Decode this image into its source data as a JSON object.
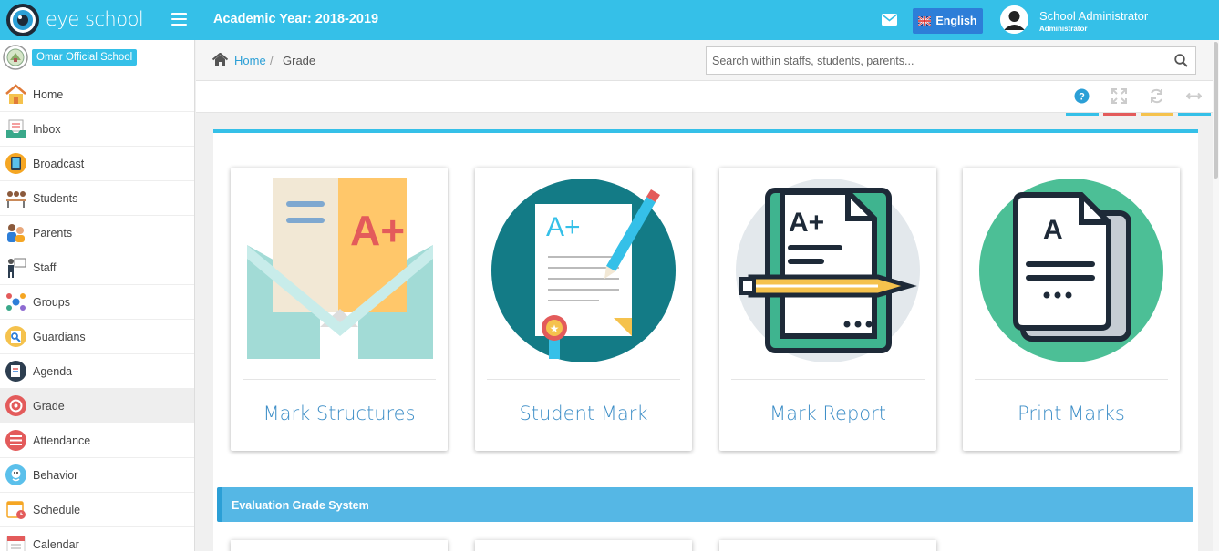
{
  "header": {
    "brand": "eye school",
    "academic_year": "Academic Year: 2018-2019",
    "language": "English",
    "user_name": "School Administrator",
    "user_role": "Administrator",
    "color": "#35c0e8"
  },
  "sidebar": {
    "school_name": "Omar Official School",
    "items": [
      {
        "label": "Home",
        "icon": "home-icon"
      },
      {
        "label": "Inbox",
        "icon": "inbox-icon"
      },
      {
        "label": "Broadcast",
        "icon": "broadcast-icon"
      },
      {
        "label": "Students",
        "icon": "students-icon"
      },
      {
        "label": "Parents",
        "icon": "parents-icon"
      },
      {
        "label": "Staff",
        "icon": "staff-icon"
      },
      {
        "label": "Groups",
        "icon": "groups-icon"
      },
      {
        "label": "Guardians",
        "icon": "guardians-icon"
      },
      {
        "label": "Agenda",
        "icon": "agenda-icon"
      },
      {
        "label": "Grade",
        "icon": "grade-icon",
        "active": true
      },
      {
        "label": "Attendance",
        "icon": "attendance-icon"
      },
      {
        "label": "Behavior",
        "icon": "behavior-icon"
      },
      {
        "label": "Schedule",
        "icon": "schedule-icon"
      },
      {
        "label": "Calendar",
        "icon": "calendar-icon"
      }
    ]
  },
  "breadcrumb": {
    "home": "Home",
    "separator": "/",
    "current": "Grade"
  },
  "search": {
    "placeholder": "Search within staffs, students, parents..."
  },
  "toolbar": {
    "tools": [
      "help-icon",
      "fullscreen-icon",
      "refresh-icon",
      "resize-icon"
    ],
    "colors": [
      "#35c0e8",
      "#e35b5b",
      "#f5c24d",
      "#35c0e8"
    ]
  },
  "cards": [
    {
      "label": "Mark Structures",
      "icon": "mark-structures-icon"
    },
    {
      "label": "Student Mark",
      "icon": "student-mark-icon"
    },
    {
      "label": "Mark Report",
      "icon": "mark-report-icon"
    },
    {
      "label": "Print Marks",
      "icon": "print-marks-icon"
    }
  ],
  "section": {
    "title": "Evaluation Grade System"
  }
}
